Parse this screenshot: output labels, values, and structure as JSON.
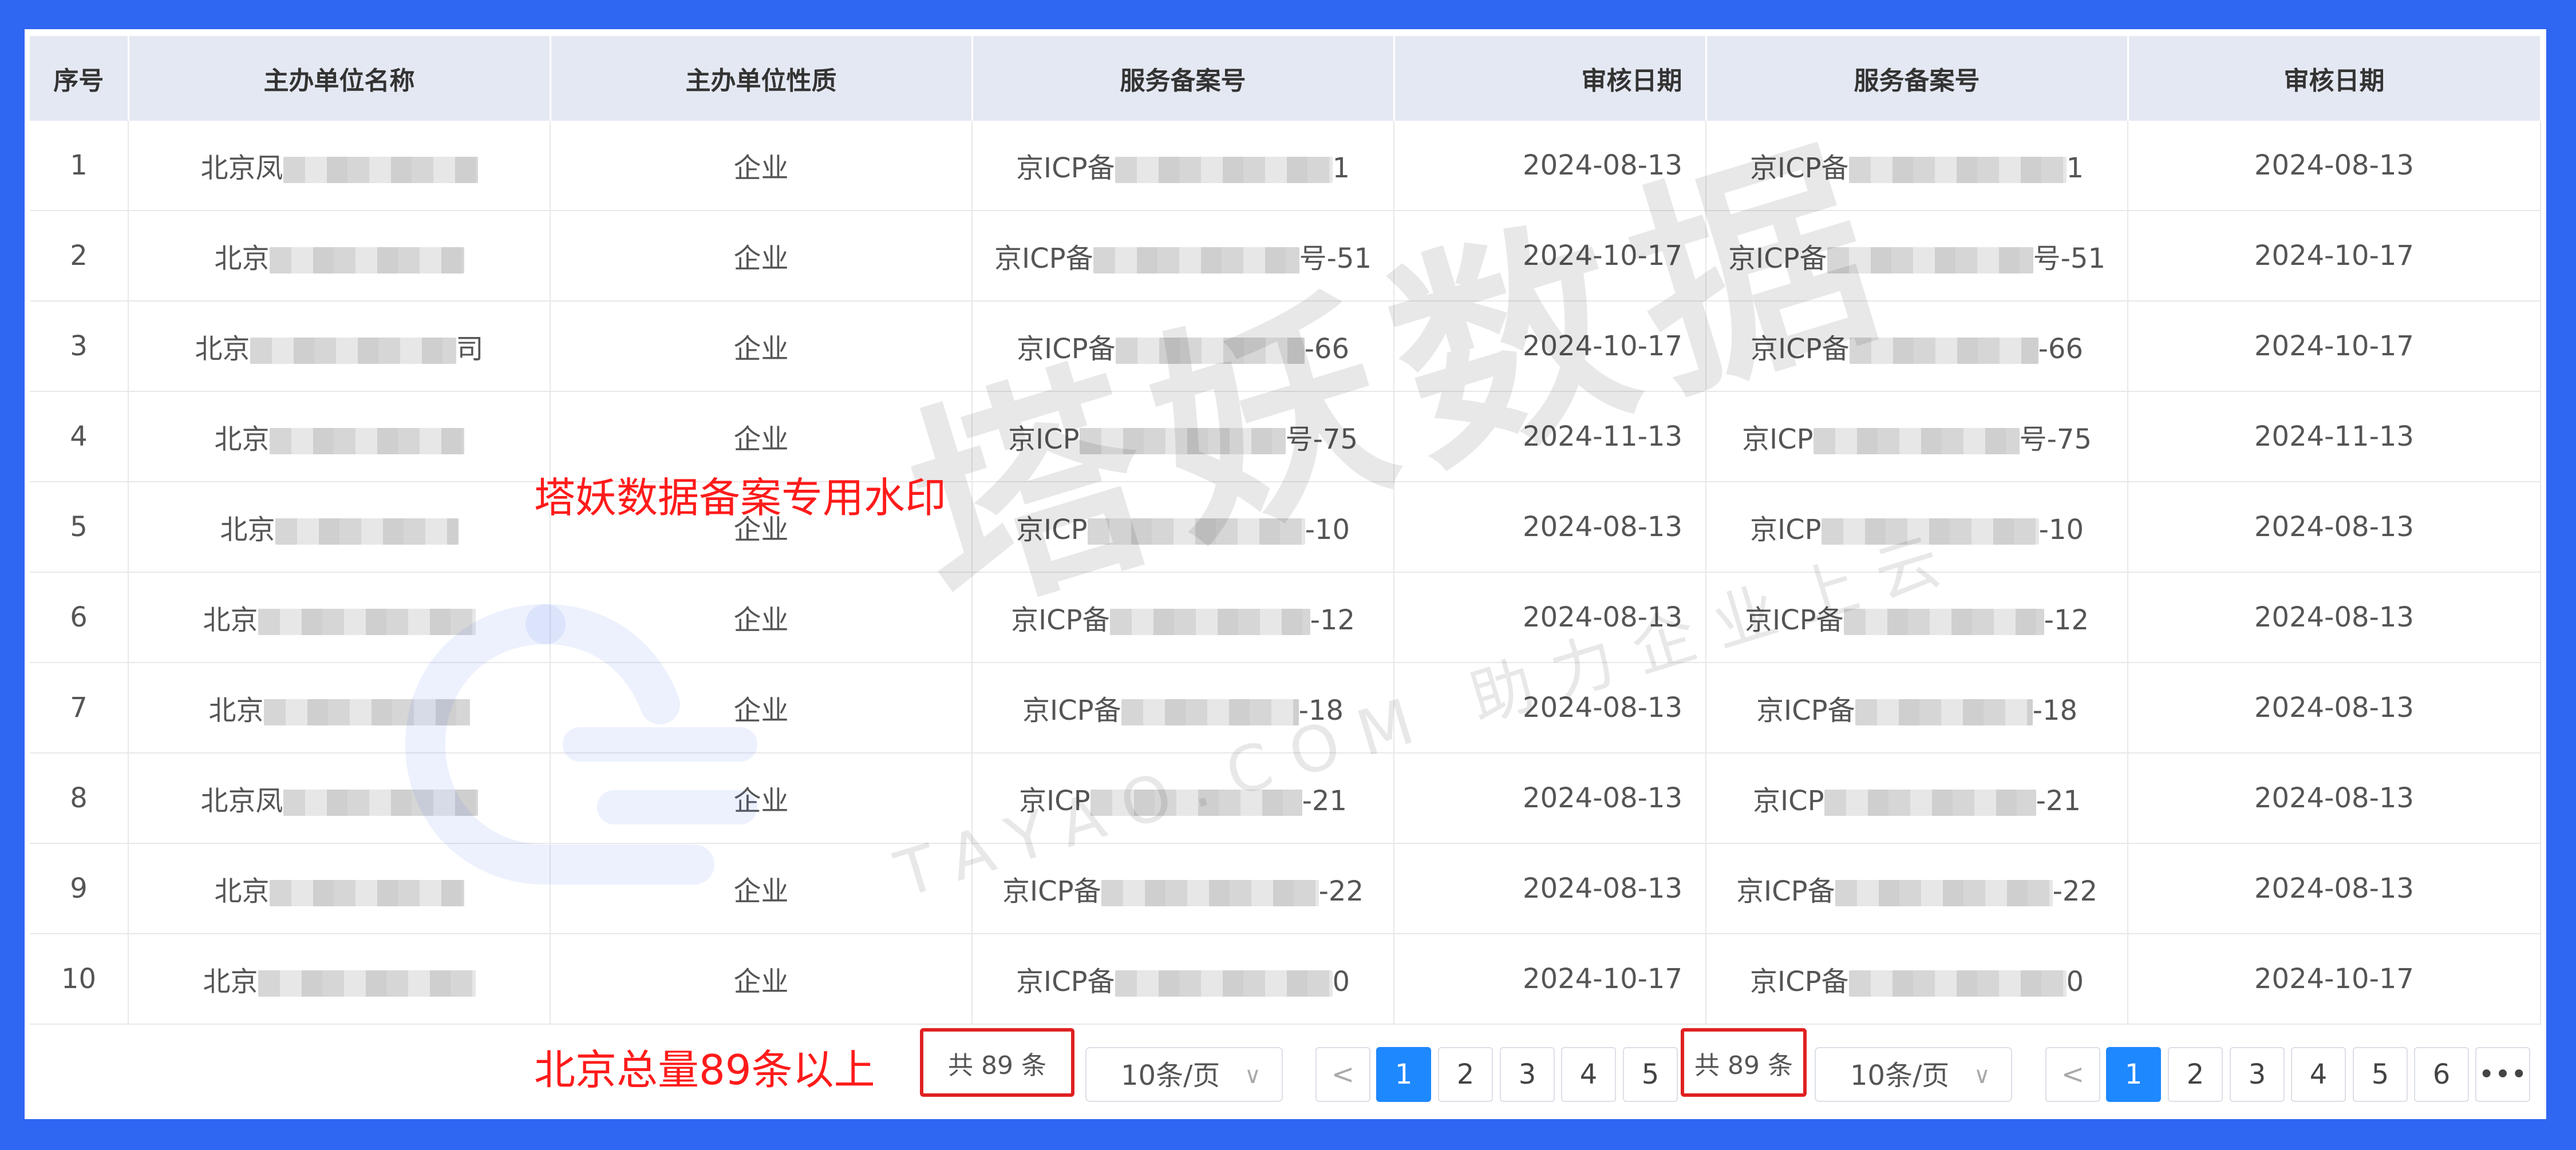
{
  "columns": [
    "序号",
    "主办单位名称",
    "主办单位性质",
    "服务备案号",
    "审核日期",
    "服务备案号",
    "审核日期"
  ],
  "rows": [
    {
      "no": "1",
      "name_prefix": "北京凤",
      "name_suffix": "",
      "type": "企业",
      "reg_prefix": "京ICP备",
      "reg_suffix": "1",
      "date": "2024-08-13"
    },
    {
      "no": "2",
      "name_prefix": "北京",
      "name_suffix": "",
      "type": "企业",
      "reg_prefix": "京ICP备",
      "reg_suffix": "号-51",
      "date": "2024-10-17"
    },
    {
      "no": "3",
      "name_prefix": "北京",
      "name_suffix": "司",
      "type": "企业",
      "reg_prefix": "京ICP备",
      "reg_suffix": "-66",
      "date": "2024-10-17"
    },
    {
      "no": "4",
      "name_prefix": "北京",
      "name_suffix": "",
      "type": "企业",
      "reg_prefix": "京ICP",
      "reg_suffix": "号-75",
      "date": "2024-11-13"
    },
    {
      "no": "5",
      "name_prefix": "北京",
      "name_suffix": "",
      "type": "企业",
      "reg_prefix": "京ICP",
      "reg_suffix": "-10",
      "date": "2024-08-13"
    },
    {
      "no": "6",
      "name_prefix": "北京",
      "name_suffix": "",
      "type": "企业",
      "reg_prefix": "京ICP备",
      "reg_suffix": "-12",
      "date": "2024-08-13"
    },
    {
      "no": "7",
      "name_prefix": "北京",
      "name_suffix": "",
      "type": "企业",
      "reg_prefix": "京ICP备",
      "reg_suffix": "-18",
      "date": "2024-08-13"
    },
    {
      "no": "8",
      "name_prefix": "北京凤",
      "name_suffix": "",
      "type": "企业",
      "reg_prefix": "京ICP",
      "reg_suffix": "-21",
      "date": "2024-08-13"
    },
    {
      "no": "9",
      "name_prefix": "北京",
      "name_suffix": "",
      "type": "企业",
      "reg_prefix": "京ICP备",
      "reg_suffix": "-22",
      "date": "2024-08-13"
    },
    {
      "no": "10",
      "name_prefix": "北京",
      "name_suffix": "",
      "type": "企业",
      "reg_prefix": "京ICP备",
      "reg_suffix": "0",
      "date": "2024-10-17"
    }
  ],
  "watermark": {
    "main": "塔妖数据",
    "sub": "TAYAO.COM 助力企业上云",
    "note": "塔妖数据备案专用水印"
  },
  "annotation": "北京总量89条以上",
  "pager_left": {
    "total": "共 89 条",
    "page_size": "10条/页",
    "pages": [
      "1",
      "2",
      "3",
      "4",
      "5"
    ],
    "current": "1"
  },
  "pager_right": {
    "total": "共 89 条",
    "page_size": "10条/页",
    "pages": [
      "1",
      "2",
      "3",
      "4",
      "5",
      "6"
    ],
    "more": "•••",
    "current": "1"
  },
  "icons": {
    "prev": "chevron-left-icon",
    "dropdown": "chevron-down-icon"
  },
  "colors": {
    "frame": "#2f66f2",
    "header_bg": "#e4e8f2",
    "accent": "#1e88ff",
    "highlight": "#e02020",
    "note": "#ff1b1b"
  }
}
